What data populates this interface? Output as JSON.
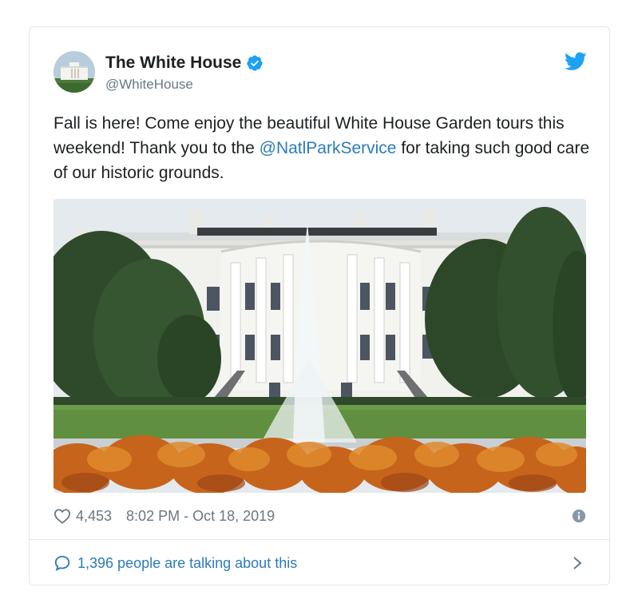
{
  "author": {
    "name": "The White House",
    "handle": "@WhiteHouse",
    "verified": true
  },
  "tweet": {
    "text_before": "Fall is here! Come enjoy the beautiful White House Garden tours this weekend! Thank you to the ",
    "mention": "@NatlParkService",
    "text_after": " for taking such good care of our historic grounds."
  },
  "photo": {
    "icon": "photo-white-house"
  },
  "meta": {
    "likes": "4,453",
    "timestamp": "8:02 PM - Oct 18, 2019"
  },
  "conversation": {
    "label": "1,396 people are talking about this"
  },
  "icons": {
    "verified": "verified-badge-icon",
    "twitter": "twitter-bird-icon",
    "like": "heart-icon",
    "info": "info-icon",
    "reply": "speech-bubble-icon",
    "chevron": "chevron-right-icon"
  },
  "colors": {
    "brand": "#1da1f2",
    "link": "#2b7bb9",
    "meta_text": "#697882",
    "border": "#e1e8ed"
  }
}
